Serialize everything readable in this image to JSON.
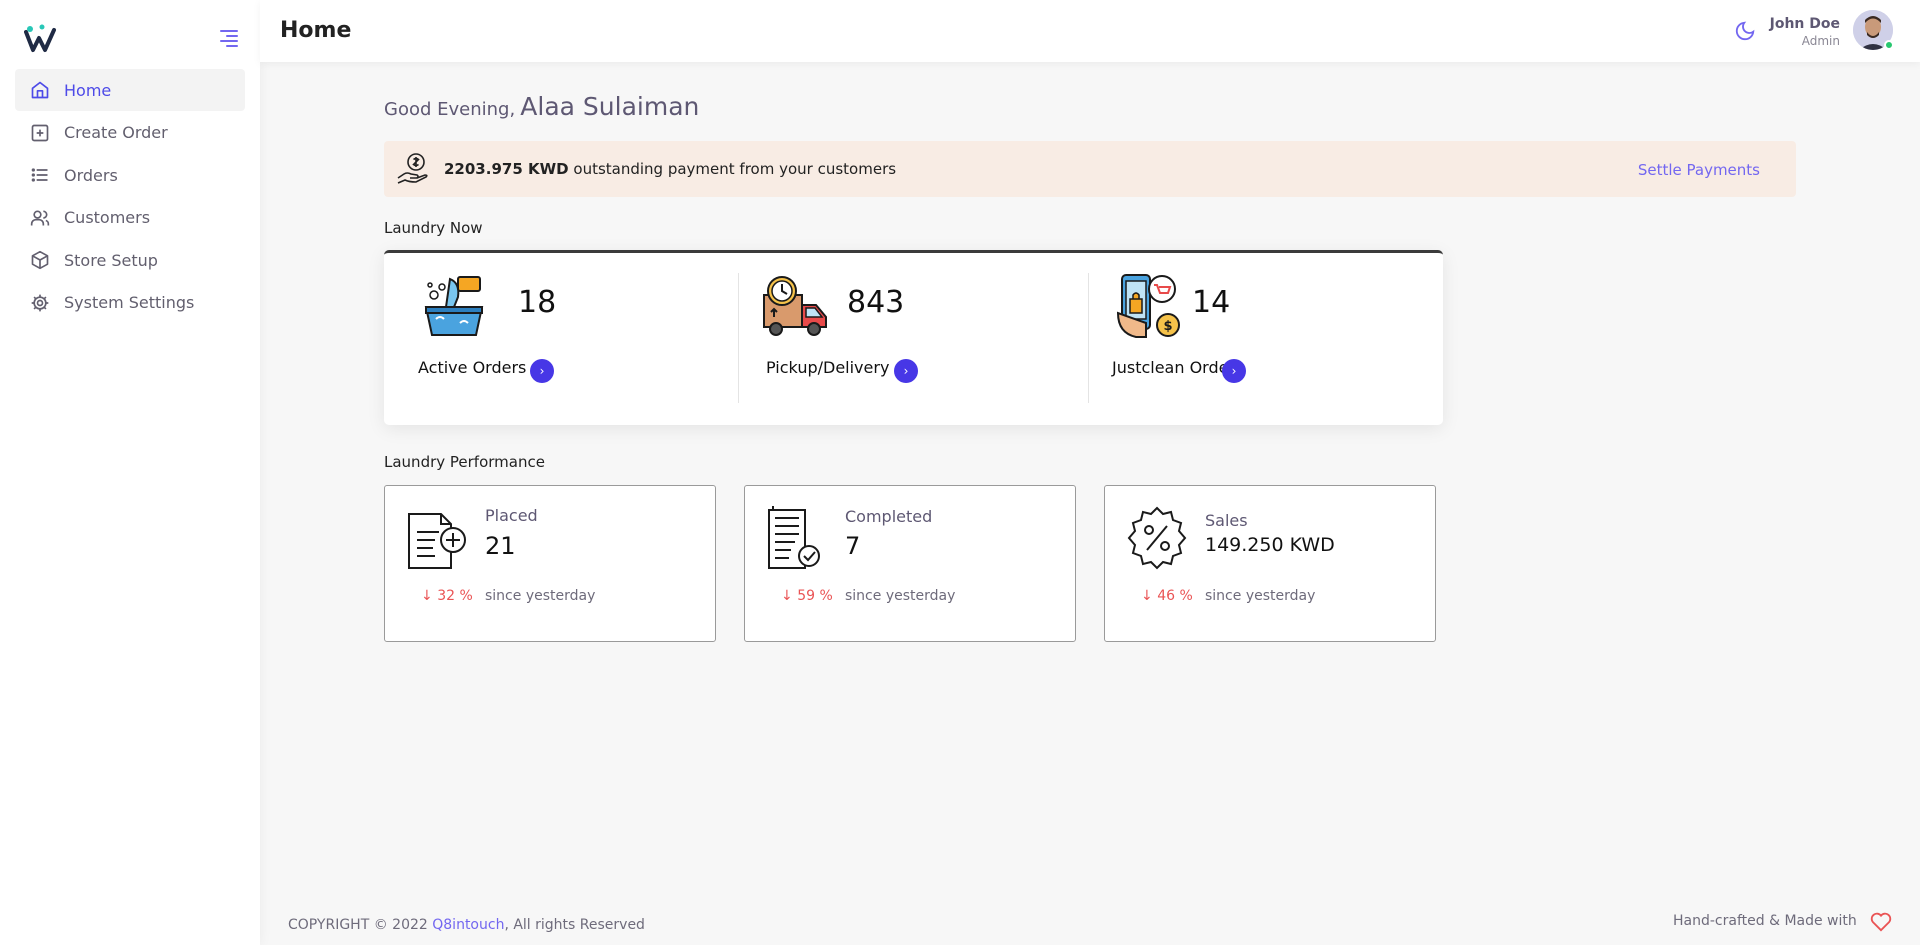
{
  "header": {
    "title": "Home",
    "user_name": "John Doe",
    "user_role": "Admin"
  },
  "sidebar": {
    "items": [
      {
        "label": "Home",
        "icon": "home-icon",
        "active": true
      },
      {
        "label": "Create Order",
        "icon": "plus-square-icon",
        "active": false
      },
      {
        "label": "Orders",
        "icon": "list-icon",
        "active": false
      },
      {
        "label": "Customers",
        "icon": "users-icon",
        "active": false
      },
      {
        "label": "Store Setup",
        "icon": "box-icon",
        "active": false
      },
      {
        "label": "System Settings",
        "icon": "gear-icon",
        "active": false
      }
    ]
  },
  "greeting": {
    "prefix": "Good Evening,",
    "name": "Alaa Sulaiman"
  },
  "alert": {
    "amount": "2203.975 KWD",
    "text": "outstanding payment from your customers",
    "action": "Settle Payments"
  },
  "laundry_now": {
    "title": "Laundry Now",
    "items": [
      {
        "value": "18",
        "label": "Active Orders",
        "icon": "laundry-basket-icon"
      },
      {
        "value": "843",
        "label": "Pickup/Delivery",
        "icon": "delivery-truck-icon"
      },
      {
        "value": "14",
        "label": "Justclean Orders",
        "icon": "mobile-order-icon"
      }
    ]
  },
  "performance": {
    "title": "Laundry Performance",
    "items": [
      {
        "label": "Placed",
        "value": "21",
        "change": "32 %",
        "since": "since yesterday",
        "icon": "document-plus-icon"
      },
      {
        "label": "Completed",
        "value": "7",
        "change": "59 %",
        "since": "since yesterday",
        "icon": "document-check-icon"
      },
      {
        "label": "Sales",
        "value": "149.250 KWD",
        "change": "46 %",
        "since": "since yesterday",
        "icon": "percent-badge-icon"
      }
    ]
  },
  "footer": {
    "copyright": "COPYRIGHT © 2022",
    "brand": "Q8intouch",
    "rights": ", All rights Reserved",
    "made_with": "Hand-crafted & Made with"
  },
  "colors": {
    "accent": "#7367f0",
    "button": "#4737e6",
    "alert_bg": "#f8ece4",
    "negative": "#ea5455"
  }
}
